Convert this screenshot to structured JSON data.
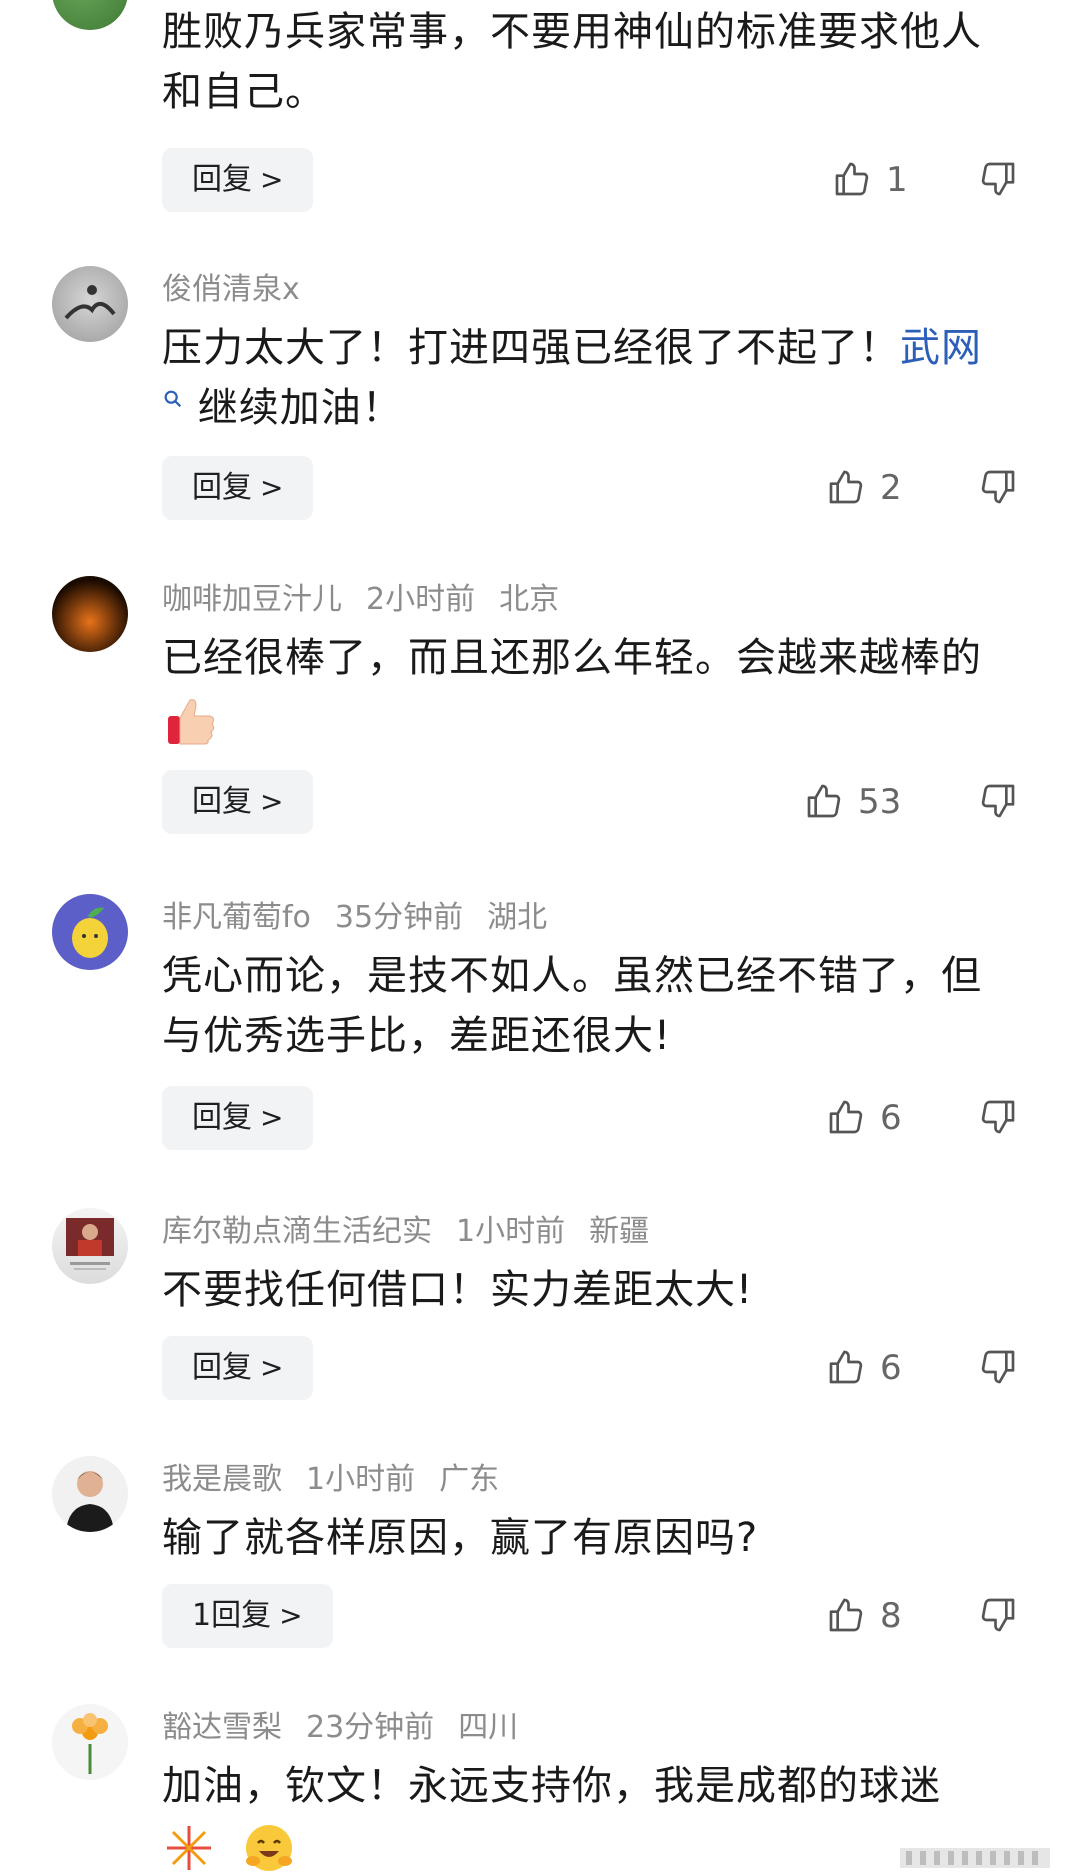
{
  "comments": [
    {
      "username": "",
      "time": "",
      "location": "",
      "text": "胜败乃兵家常事，不要用神仙的标准要求他人和自己。",
      "reply_label": "回复",
      "likes": "1"
    },
    {
      "username": "俊俏清泉x",
      "time": "",
      "location": "",
      "text": "压力太大了！打进四强已经很了不起了！",
      "link_text": "武网",
      "text_after_link": "继续加油！",
      "reply_label": "回复",
      "likes": "2"
    },
    {
      "username": "咖啡加豆汁儿",
      "time": "2小时前",
      "location": "北京",
      "text": "已经很棒了，而且还那么年轻。会越来越棒的",
      "reply_label": "回复",
      "likes": "53"
    },
    {
      "username": "非凡葡萄fo",
      "time": "35分钟前",
      "location": "湖北",
      "text": "凭心而论，是技不如人。虽然已经不错了，但与优秀选手比，差距还很大!",
      "reply_label": "回复",
      "likes": "6"
    },
    {
      "username": "库尔勒点滴生活纪实",
      "time": "1小时前",
      "location": "新疆",
      "text": "不要找任何借口！实力差距太大!",
      "reply_label": "回复",
      "likes": "6"
    },
    {
      "username": "我是晨歌",
      "time": "1小时前",
      "location": "广东",
      "text": "输了就各样原因，赢了有原因吗?",
      "reply_label": "1回复",
      "likes": "8"
    },
    {
      "username": "豁达雪梨",
      "time": "23分钟前",
      "location": "四川",
      "text": "加油，钦文！永远支持你，我是成都的球迷",
      "reply_label": "",
      "likes": ""
    }
  ],
  "icons": {
    "like": "thumbs-up-outline-icon",
    "dislike": "thumbs-down-outline-icon",
    "chevron": "chevron-right-icon"
  },
  "colors": {
    "link": "#2b5fb8",
    "meta": "#8c8c8c",
    "reply_bg": "#f2f3f5"
  }
}
